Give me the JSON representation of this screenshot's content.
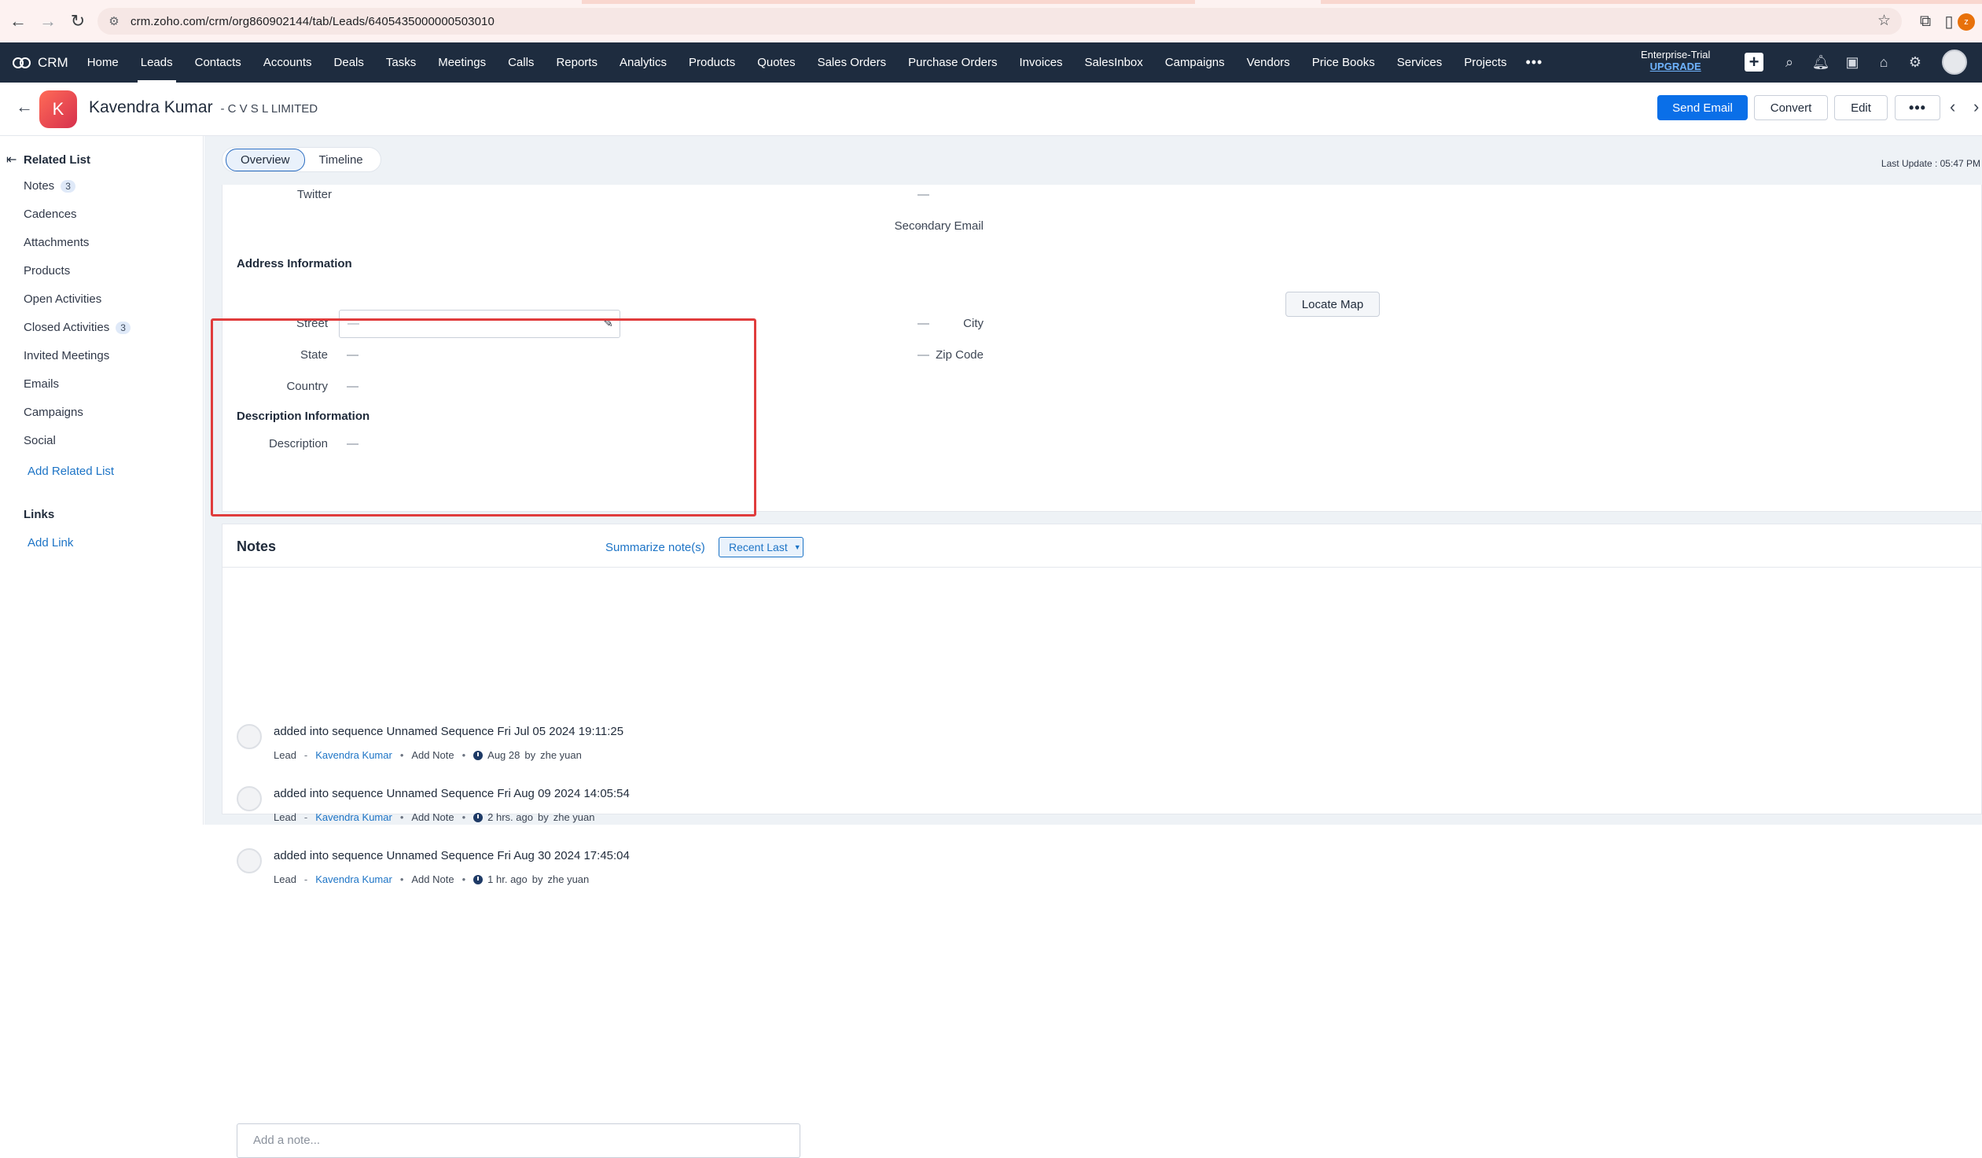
{
  "browser": {
    "url": "crm.zoho.com/crm/org860902144/tab/Leads/6405435000000503010",
    "profile_initial": "z"
  },
  "topnav": {
    "brand": "CRM",
    "items": [
      "Home",
      "Leads",
      "Contacts",
      "Accounts",
      "Deals",
      "Tasks",
      "Meetings",
      "Calls",
      "Reports",
      "Analytics",
      "Products",
      "Quotes",
      "Sales Orders",
      "Purchase Orders",
      "Invoices",
      "SalesInbox",
      "Campaigns",
      "Vendors",
      "Price Books",
      "Services",
      "Projects"
    ],
    "active_item": "Leads",
    "more": "•••",
    "trial_label": "Enterprise-Trial",
    "upgrade_label": "UPGRADE"
  },
  "record": {
    "avatar_initial": "K",
    "name": "Kavendra Kumar",
    "company": "- C V S L LIMITED",
    "buttons": {
      "send_email": "Send Email",
      "convert": "Convert",
      "edit": "Edit",
      "more": "•••"
    }
  },
  "related_list": {
    "title": "Related List",
    "items": [
      {
        "label": "Notes",
        "count": "3"
      },
      {
        "label": "Cadences"
      },
      {
        "label": "Attachments"
      },
      {
        "label": "Products"
      },
      {
        "label": "Open Activities"
      },
      {
        "label": "Closed Activities",
        "count": "3"
      },
      {
        "label": "Invited Meetings"
      },
      {
        "label": "Emails"
      },
      {
        "label": "Campaigns"
      },
      {
        "label": "Social"
      }
    ],
    "add_related": "Add Related List",
    "links_title": "Links",
    "add_link": "Add Link"
  },
  "tabs": {
    "overview": "Overview",
    "timeline": "Timeline",
    "last_update": "Last Update : 05:47 PM"
  },
  "details": {
    "twitter_label": "Twitter",
    "twitter_value": "—",
    "secondary_email_label": "Secondary Email",
    "secondary_email_value": "—",
    "address_title": "Address Information",
    "locate_map": "Locate Map",
    "street_label": "Street",
    "street_value": "—",
    "city_label": "City",
    "city_value": "—",
    "state_label": "State",
    "state_value": "—",
    "zip_label": "Zip Code",
    "zip_value": "—",
    "country_label": "Country",
    "country_value": "—",
    "description_title": "Description Information",
    "description_label": "Description",
    "description_value": "—"
  },
  "notes": {
    "title": "Notes",
    "summarize": "Summarize note(s)",
    "sort": "Recent Last",
    "entries": [
      {
        "text": "added into sequence Unnamed Sequence Fri Jul 05 2024 19:11:25",
        "module": "Lead",
        "record": "Kavendra Kumar",
        "action": "Add Note",
        "time": "Aug 28",
        "by": "by",
        "author": "zhe yuan"
      },
      {
        "text": "added into sequence Unnamed Sequence Fri Aug 09 2024 14:05:54",
        "module": "Lead",
        "record": "Kavendra Kumar",
        "action": "Add Note",
        "time": "2 hrs. ago",
        "by": "by",
        "author": "zhe yuan"
      },
      {
        "text": "added into sequence Unnamed Sequence Fri Aug 30 2024 17:45:04",
        "module": "Lead",
        "record": "Kavendra Kumar",
        "action": "Add Note",
        "time": "1 hr. ago",
        "by": "by",
        "author": "zhe yuan"
      }
    ],
    "add_placeholder": "Add a note..."
  },
  "colors": {
    "topnav_bg": "#1e2c3f",
    "primary_blue": "#0a6fe8",
    "link_blue": "#1d74c6",
    "highlight_red": "#e03c3c",
    "avatar_gradient": "#e2404f"
  }
}
